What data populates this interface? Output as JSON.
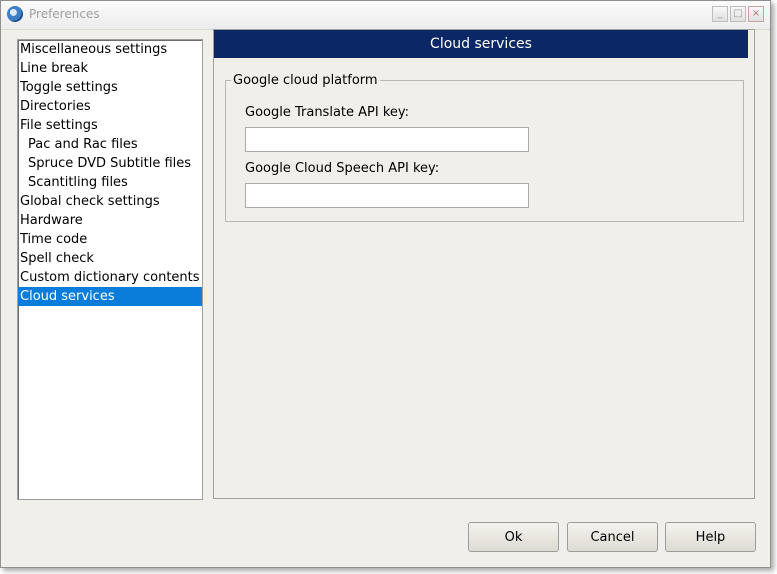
{
  "window": {
    "title": "Preferences",
    "controls": {
      "minimize": "_",
      "maximize": "□",
      "close": "×"
    }
  },
  "tree": {
    "items": [
      {
        "label": "Miscellaneous settings",
        "level": 0,
        "selected": false
      },
      {
        "label": "Line break",
        "level": 0,
        "selected": false
      },
      {
        "label": "Toggle settings",
        "level": 0,
        "selected": false
      },
      {
        "label": "Directories",
        "level": 0,
        "selected": false
      },
      {
        "label": "File settings",
        "level": 0,
        "selected": false
      },
      {
        "label": "Pac and Rac files",
        "level": 1,
        "selected": false
      },
      {
        "label": "Spruce DVD Subtitle files",
        "level": 1,
        "selected": false
      },
      {
        "label": "Scantitling files",
        "level": 1,
        "selected": false
      },
      {
        "label": "Global check settings",
        "level": 0,
        "selected": false
      },
      {
        "label": "Hardware",
        "level": 0,
        "selected": false
      },
      {
        "label": "Time code",
        "level": 0,
        "selected": false
      },
      {
        "label": "Spell check",
        "level": 0,
        "selected": false
      },
      {
        "label": "Custom dictionary contents",
        "level": 0,
        "selected": false
      },
      {
        "label": "Cloud services",
        "level": 0,
        "selected": true
      }
    ]
  },
  "panel": {
    "header": "Cloud services",
    "group": {
      "legend": "Google cloud platform",
      "translate_label": "Google Translate API key:",
      "translate_value": "",
      "speech_label": "Google Cloud Speech API key:",
      "speech_value": ""
    }
  },
  "buttons": {
    "ok": "Ok",
    "cancel": "Cancel",
    "help": "Help"
  },
  "colors": {
    "header_bg": "#0b2766",
    "selection_bg": "#0a7ddb",
    "window_bg": "#f1efea"
  }
}
